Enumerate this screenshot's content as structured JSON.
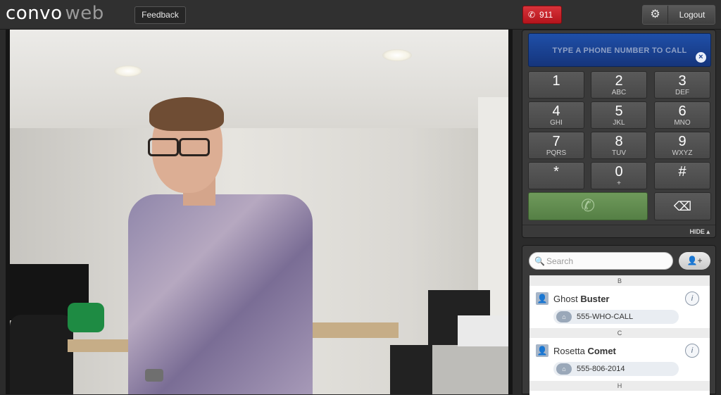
{
  "header": {
    "logo_main": "convo",
    "logo_sub": "web",
    "feedback_label": "Feedback",
    "emergency_label": "911",
    "logout_label": "Logout"
  },
  "dialpad": {
    "placeholder": "TYPE A PHONE NUMBER TO CALL",
    "keys": [
      {
        "num": "1",
        "letters": ""
      },
      {
        "num": "2",
        "letters": "ABC"
      },
      {
        "num": "3",
        "letters": "DEF"
      },
      {
        "num": "4",
        "letters": "GHI"
      },
      {
        "num": "5",
        "letters": "JKL"
      },
      {
        "num": "6",
        "letters": "MNO"
      },
      {
        "num": "7",
        "letters": "PQRS"
      },
      {
        "num": "8",
        "letters": "TUV"
      },
      {
        "num": "9",
        "letters": "WXYZ"
      },
      {
        "num": "*",
        "letters": ""
      },
      {
        "num": "0",
        "letters": "+"
      },
      {
        "num": "#",
        "letters": ""
      }
    ],
    "hide_label": "HIDE"
  },
  "contacts": {
    "search_placeholder": "Search",
    "sections": [
      {
        "letter": "B",
        "first": "Ghost",
        "last": "Buster",
        "number": "555-WHO-CALL"
      },
      {
        "letter": "C",
        "first": "Rosetta",
        "last": "Comet",
        "number": "555-806-2014"
      },
      {
        "letter": "H"
      }
    ]
  },
  "colors": {
    "accent_blue": "#1f4fa8",
    "call_green": "#6f9a5b",
    "emergency_red": "#c4202a"
  },
  "icons": {
    "phone": "phone-icon",
    "gear": "gear-icon",
    "search": "search-icon",
    "add_contact": "add-contact-icon",
    "backspace": "backspace-icon",
    "contact": "contact-avatar-icon",
    "info": "info-icon",
    "home": "home-icon"
  }
}
